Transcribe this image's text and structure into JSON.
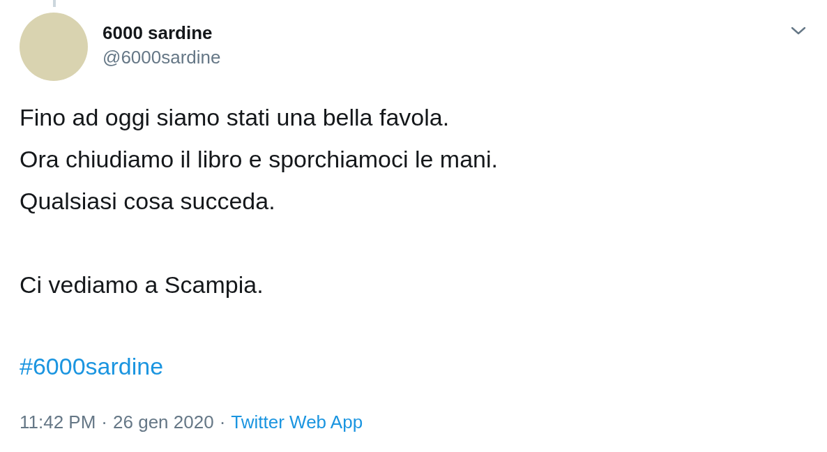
{
  "author": {
    "name": "6000 sardine",
    "handle": "@6000sardine"
  },
  "paragraphs": [
    "Fino ad oggi siamo stati una bella favola.\nOra chiudiamo il libro e sporchiamoci le mani.\nQualsiasi cosa succeda.",
    "Ci vediamo a Scampia."
  ],
  "hashtag": "#6000sardine",
  "meta": {
    "time": "11:42 PM",
    "separator": "·",
    "date": "26 gen 2020",
    "source": "Twitter Web App"
  }
}
